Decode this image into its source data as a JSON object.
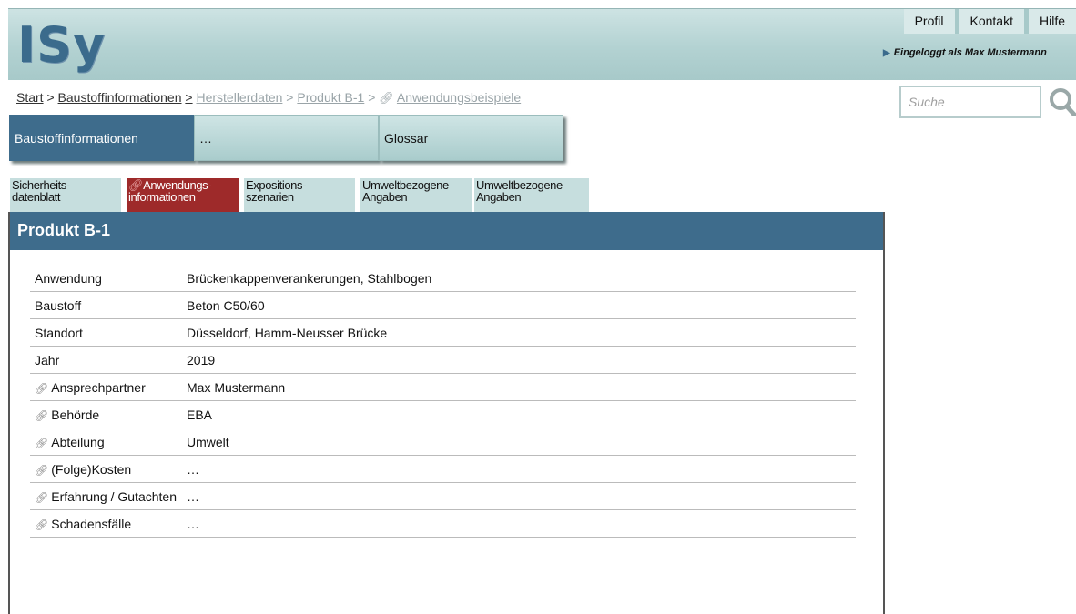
{
  "header": {
    "logo": "ISy",
    "nav": [
      "Profil",
      "Kontakt",
      "Hilfe"
    ],
    "logged_in": "Eingeloggt als Max Mustermann"
  },
  "breadcrumb": {
    "items": [
      "Start",
      "Baustoffinformationen",
      "Herstellerdaten",
      "Produkt B-1",
      "Anwendungsbeispiele"
    ],
    "separator": ">"
  },
  "search": {
    "placeholder": "Suche"
  },
  "main_nav": [
    {
      "label": "Baustoffinformationen",
      "active": true
    },
    {
      "label": "…",
      "active": false
    },
    {
      "label": "Glossar",
      "active": false
    }
  ],
  "sub_tabs": [
    {
      "line1": "Sicherheits-",
      "line2": "datenblatt",
      "active": false
    },
    {
      "line1": "Anwendungs-",
      "line2": "informationen",
      "active": true
    },
    {
      "line1": "Expositions-",
      "line2": "szenarien",
      "active": false
    },
    {
      "line1": "Umweltbezogene",
      "line2": "Angaben",
      "active": false
    },
    {
      "line1": "Umweltbezogene",
      "line2": "Angaben",
      "active": false
    }
  ],
  "panel": {
    "title": "Produkt B-1",
    "rows": [
      {
        "label": "Anwendung",
        "value": "Brückenkappenverankerungen, Stahlbogen",
        "link": false
      },
      {
        "label": "Baustoff",
        "value": "Beton C50/60",
        "link": false
      },
      {
        "label": "Standort",
        "value": "Düsseldorf, Hamm-Neusser Brücke",
        "link": false
      },
      {
        "label": "Jahr",
        "value": "2019",
        "link": false
      },
      {
        "label": "Ansprechpartner",
        "value": "Max Mustermann",
        "link": true
      },
      {
        "label": "Behörde",
        "value": "EBA",
        "link": true
      },
      {
        "label": "Abteilung",
        "value": "Umwelt",
        "link": true
      },
      {
        "label": "(Folge)Kosten",
        "value": "…",
        "link": true
      },
      {
        "label": "Erfahrung / Gutachten",
        "value": "…",
        "link": true
      },
      {
        "label": "Schadensfälle",
        "value": "…",
        "link": true
      }
    ]
  },
  "colors": {
    "header_bg": "#b3d2d2",
    "accent_blue": "#3e6c8c",
    "active_tab_red": "#9e2a2a",
    "tab_bg": "#c6dede"
  },
  "icons": {
    "link": "link-icon",
    "search": "search-icon",
    "logged_arrow": "arrow-right-icon"
  }
}
